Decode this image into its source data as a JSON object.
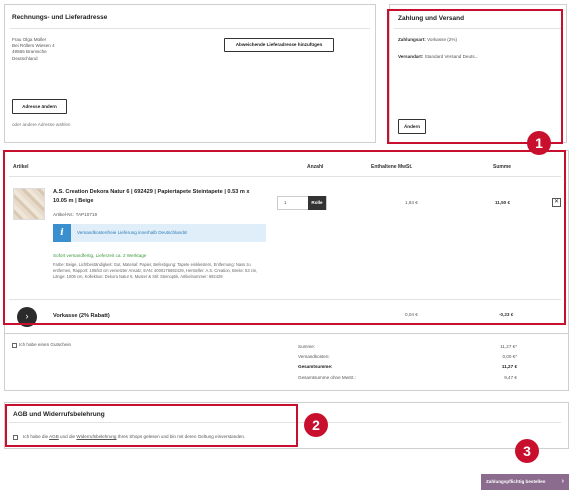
{
  "address": {
    "title": "Rechnungs- und Lieferadresse",
    "lines": [
      "Frau Olga Müller",
      "Bei Röllers Wiesen 4",
      "49565 Bramsche",
      "Deutschland"
    ],
    "change_button": "Adresse ändern",
    "other_address_link": "oder andere Adresse wählen",
    "different_delivery_button": "Abweichende Lieferadresse hinzufügen"
  },
  "payment": {
    "title": "Zahlung und Versand",
    "payment_label": "Zahlungsart:",
    "payment_value": "Vorkasse (2%)",
    "shipping_label": "Versandart:",
    "shipping_value": "Standard Versand Deuts...",
    "change_button": "Ändern"
  },
  "table": {
    "headers": {
      "article": "Artikel",
      "quantity": "Anzahl",
      "vat": "Enthaltene MwSt.",
      "sum": "Summe"
    }
  },
  "product": {
    "name": "A.S. Creation Dekora Natur 6 | 692429 | Papiertapete Steintapete | 0.53 m x 10.05 m | Beige",
    "article_no": "Artikel-Nr.: TAP10719",
    "free_shipping_notice": "Versandkostenfreie Lieferung innerhalb Deutschlands!",
    "delivery_status": "Sofort versandfertig, Lieferzeit ca. 2 Werktage",
    "description": "Farbe: Beige, Lichtbeständigkeit: Gut, Material: Papier, Befestigung: Tapete einkleistern, Entfernung: Nass zu entfernen, Rapport: 106/53 cm versetzter Ansatz, EAN: 4000176692429, Hersteller: A.S. Creation, Breite: 53 cm, Länge: 1005 cm, Kollektion: Dekora Natur 6, Muster & Stil: Steinoptik, Artikelnummer: 692429",
    "quantity": "1",
    "unit": "Rolle",
    "vat": "1,84 €",
    "sum": "11,50 €",
    "remove_icon": "close-icon"
  },
  "discount": {
    "label": "Vorkasse (2% Rabatt)",
    "vat": "0,04 €",
    "sum": "-0,23 €"
  },
  "voucher": {
    "label": "Ich habe einen Gutschein"
  },
  "summary": {
    "rows": [
      {
        "label": "Summe:",
        "value": "11,27 €*"
      },
      {
        "label": "Versandkosten:",
        "value": "0,00 €*"
      },
      {
        "label": "Gesamtsumme:",
        "value": "11,27 €"
      },
      {
        "label": "Gesamtsumme ohne MwSt.:",
        "value": "9,47 €"
      }
    ]
  },
  "terms": {
    "title": "AGB und Widerrufsbelehrung",
    "text_before": "Ich habe die ",
    "agb_link": "AGB",
    "text_middle": " und die ",
    "withdrawal_link": "Widerrufsbelehrung",
    "text_after": " Ihres Shops gelesen und bin mit deren Geltung einverstanden."
  },
  "order_button": {
    "label": "Zahlungspflichtig bestellen",
    "icon": "chevron-right-icon"
  },
  "annotations": [
    "1",
    "2",
    "3"
  ],
  "colors": {
    "accent": "#c8102e",
    "order_button": "#8b6b8e",
    "info_blue": "#dfeef8",
    "info_icon": "#3a8fcf",
    "success": "#3c9a3c"
  }
}
